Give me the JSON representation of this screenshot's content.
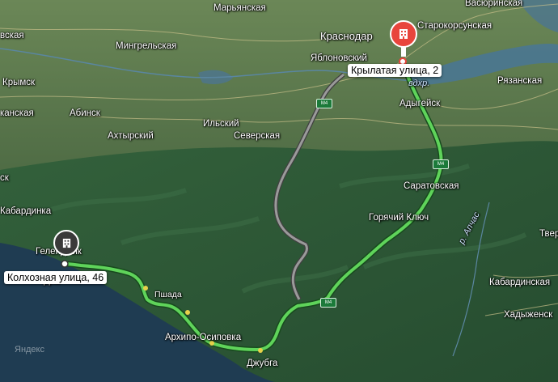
{
  "map": {
    "places": {
      "maryanskaya": "Марьянская",
      "krasnodar": "Краснодар",
      "starokorsunskaya": "Старокорсунская",
      "vasyurinskaya": "Васюринская",
      "vskaya": "вская",
      "mingrelskaya": "Мингрельская",
      "yablonovsky": "Яблоновский",
      "krymsk": "Крымск",
      "abinsk": "Абинск",
      "ryazanskaya": "Рязанская",
      "kanskaya": "канская",
      "adygeysk": "Адыгейск",
      "akhtyrsky": "Ахтырский",
      "ilsky": "Ильский",
      "severskaya": "Северская",
      "saratovskaya": "Саратовская",
      "sk": "ск",
      "kabardinka": "Кабардинка",
      "goryachy_klyuch": "Горячий Ключ",
      "tver": "Твер",
      "gelendzhik": "Геленджик",
      "pshada": "Пшада",
      "kabardinskaya": "Кабардинская",
      "arkhipo_osipovka": "Архипо-Осиповка",
      "khadyzhensk": "Хадыженск",
      "dzhubga": "Джубга",
      "divnomorskoe_prefix": "Див"
    },
    "water_labels": {
      "reservoir": "вдхр.",
      "apchas_river": "р. Апчас"
    },
    "route": {
      "destination": "Крылатая улица, 2",
      "origin": "Колхозная улица, 46",
      "route_color": "#5fd35a",
      "alt_route_color": "#9a9a9a"
    },
    "road_shields": {
      "a": "М4",
      "b": "М4",
      "c": "М4"
    },
    "watermark": "Яндекс"
  },
  "colors": {
    "sea": "#1f3c52",
    "forest": "#2f5b38",
    "plain": "#5d7a4f",
    "pin_red": "#e8453c",
    "pin_dark": "#3a3a3a"
  },
  "icons": {
    "destination_pin": "building-icon",
    "origin_pin": "building-icon"
  }
}
